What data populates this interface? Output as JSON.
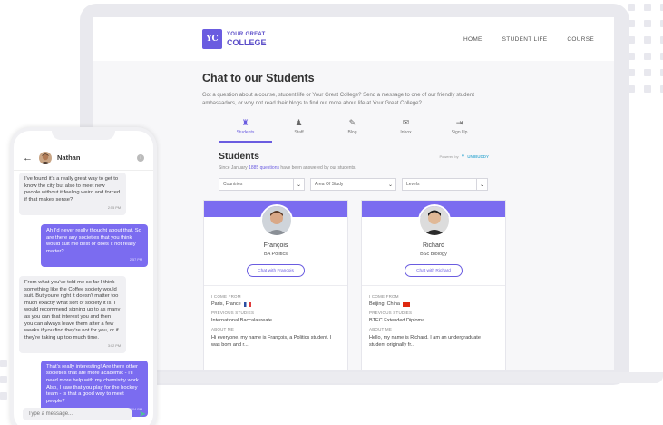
{
  "site": {
    "logo_mark": "YC",
    "logo_line1": "YOUR GREAT",
    "logo_line2": "COLLEGE",
    "nav": [
      "HOME",
      "STUDENT LIFE",
      "COURSE"
    ]
  },
  "page": {
    "title": "Chat to our Students",
    "intro": "Got a question about a course, student life or Your Great College? Send a message to one of our friendly student ambassadors, or why not read their blogs to find out more about life at Your Great College?"
  },
  "tabs": [
    {
      "label": "Students",
      "icon": "graduation-cap-icon",
      "glyph": "♜",
      "active": true
    },
    {
      "label": "Staff",
      "icon": "staff-icon",
      "glyph": "♟",
      "active": false
    },
    {
      "label": "Blog",
      "icon": "pen-icon",
      "glyph": "✎",
      "active": false
    },
    {
      "label": "Inbox",
      "icon": "chat-bubble-icon",
      "glyph": "✉",
      "active": false
    },
    {
      "label": "Sign Up",
      "icon": "sign-in-icon",
      "glyph": "⇥",
      "active": false
    }
  ],
  "students": {
    "title": "Students",
    "powered_by": "Powered by",
    "powered_brand": "UNIBUDDY",
    "since_prefix": "Since January",
    "since_count": "1885 questions",
    "since_suffix": "have been answered by our students."
  },
  "filters": [
    "Countries",
    "Area Of Study",
    "Levels"
  ],
  "cards": [
    {
      "name": "François",
      "course": "BA Politics",
      "button": "Chat with François",
      "come_from_label": "I COME FROM",
      "come_from": "Paris, France",
      "flag": "france",
      "prev_label": "PREVIOUS STUDIES",
      "prev": "International Baccalaureate",
      "about_label": "ABOUT ME",
      "about": "Hi everyone, my name is François, a Politics student. I was born and r..."
    },
    {
      "name": "Richard",
      "course": "BSc Biology",
      "button": "Chat with Richard",
      "come_from_label": "I COME FROM",
      "come_from": "Beijing, China",
      "flag": "china",
      "prev_label": "PREVIOUS STUDIES",
      "prev": "BTEC Extended Diploma",
      "about_label": "ABOUT ME",
      "about": "Hello, my name is Richard. I am an undergraduate student originally fr..."
    }
  ],
  "chat": {
    "name": "Nathan",
    "messages": [
      {
        "dir": "in",
        "text": "I've found it's a really great way to get to know the city but also to meet new people without it feeling weird and forced if that makes sense?",
        "time": "2:55 PM"
      },
      {
        "dir": "out",
        "text": "Ah I'd never really thought about that. So are there any societies that you think would suit me best or does it not really matter?",
        "time": "2:57 PM"
      },
      {
        "dir": "in",
        "text": "From what you've told me so far I think something like the Coffee society would suit. But you're right it doesn't matter too much exactly what sort of society it is. I would recommend signing up to as many as you can that interest you and then you can always leave them after a few weeks if you find they're not for you, or if they're taking up too much time.",
        "time": "3:02 PM"
      },
      {
        "dir": "out",
        "text": "That's really interesting! Are there other societies that are more academic - I'll need more help with my chemistry work. Also, I saw that you play for the hockey team - is that a good way to meet people?",
        "time": "3:04 PM"
      }
    ],
    "composer_placeholder": "Type a message..."
  },
  "colors": {
    "accent": "#7b6cf0",
    "send": "#4fc19a"
  }
}
